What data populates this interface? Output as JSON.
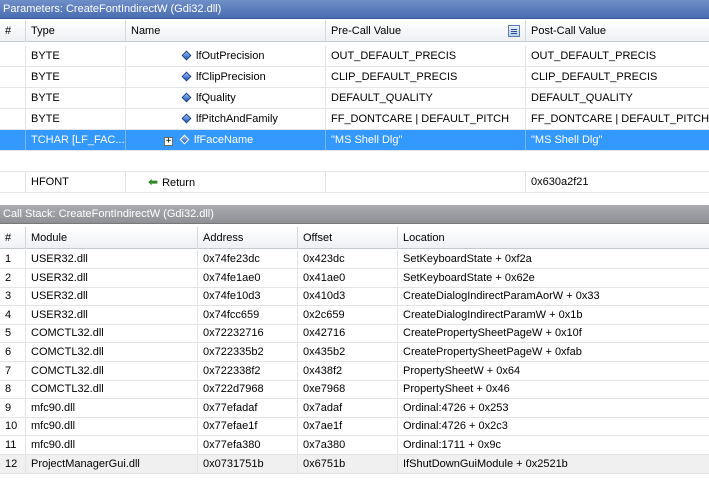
{
  "params_panel": {
    "title": "Parameters: CreateFontIndirectW (Gdi32.dll)",
    "columns": {
      "num": "#",
      "type": "Type",
      "name": "Name",
      "pre": "Pre-Call Value",
      "post": "Post-Call Value"
    },
    "rows": [
      {
        "num": "",
        "type": "BYTE",
        "name": "lfOutPrecision",
        "pre": "OUT_DEFAULT_PRECIS",
        "post": "OUT_DEFAULT_PRECIS"
      },
      {
        "num": "",
        "type": "BYTE",
        "name": "lfClipPrecision",
        "pre": "CLIP_DEFAULT_PRECIS",
        "post": "CLIP_DEFAULT_PRECIS"
      },
      {
        "num": "",
        "type": "BYTE",
        "name": "lfQuality",
        "pre": "DEFAULT_QUALITY",
        "post": "DEFAULT_QUALITY"
      },
      {
        "num": "",
        "type": "BYTE",
        "name": "lfPitchAndFamily",
        "pre": "FF_DONTCARE | DEFAULT_PITCH",
        "post": "FF_DONTCARE | DEFAULT_PITCH"
      },
      {
        "num": "",
        "type": "TCHAR [LF_FAC...",
        "name": "lfFaceName",
        "pre": "\"MS Shell Dlg\"",
        "post": "\"MS Shell Dlg\""
      }
    ],
    "selected_row": 4,
    "return_row": {
      "type": "HFONT",
      "name": "Return",
      "pre": "",
      "post": "0x630a2f21"
    }
  },
  "callstack_panel": {
    "title": "Call Stack: CreateFontIndirectW (Gdi32.dll)",
    "columns": {
      "num": "#",
      "module": "Module",
      "address": "Address",
      "offset": "Offset",
      "location": "Location"
    },
    "rows": [
      {
        "num": "1",
        "module": "USER32.dll",
        "address": "0x74fe23dc",
        "offset": "0x423dc",
        "location": "SetKeyboardState + 0xf2a"
      },
      {
        "num": "2",
        "module": "USER32.dll",
        "address": "0x74fe1ae0",
        "offset": "0x41ae0",
        "location": "SetKeyboardState + 0x62e"
      },
      {
        "num": "3",
        "module": "USER32.dll",
        "address": "0x74fe10d3",
        "offset": "0x410d3",
        "location": "CreateDialogIndirectParamAorW + 0x33"
      },
      {
        "num": "4",
        "module": "USER32.dll",
        "address": "0x74fcc659",
        "offset": "0x2c659",
        "location": "CreateDialogIndirectParamW + 0x1b"
      },
      {
        "num": "5",
        "module": "COMCTL32.dll",
        "address": "0x72232716",
        "offset": "0x42716",
        "location": "CreatePropertySheetPageW + 0x10f"
      },
      {
        "num": "6",
        "module": "COMCTL32.dll",
        "address": "0x722335b2",
        "offset": "0x435b2",
        "location": "CreatePropertySheetPageW + 0xfab"
      },
      {
        "num": "7",
        "module": "COMCTL32.dll",
        "address": "0x722338f2",
        "offset": "0x438f2",
        "location": "PropertySheetW + 0x64"
      },
      {
        "num": "8",
        "module": "COMCTL32.dll",
        "address": "0x722d7968",
        "offset": "0xe7968",
        "location": "PropertySheet + 0x46"
      },
      {
        "num": "9",
        "module": "mfc90.dll",
        "address": "0x77efadaf",
        "offset": "0x7adaf",
        "location": "Ordinal:4726 + 0x253"
      },
      {
        "num": "10",
        "module": "mfc90.dll",
        "address": "0x77efae1f",
        "offset": "0x7ae1f",
        "location": "Ordinal:4726 + 0x2c3"
      },
      {
        "num": "11",
        "module": "mfc90.dll",
        "address": "0x77efa380",
        "offset": "0x7a380",
        "location": "Ordinal:1711 + 0x9c"
      },
      {
        "num": "12",
        "module": "ProjectManagerGui.dll",
        "address": "0x0731751b",
        "offset": "0x6751b",
        "location": "IfShutDownGuiModule + 0x2521b"
      }
    ],
    "highlighted_row": 11
  },
  "icons": {
    "param": "blue-diamond-icon",
    "expand": "plus-expand-icon",
    "return": "green-arrow-icon",
    "column_chooser": "column-chooser-icon"
  }
}
